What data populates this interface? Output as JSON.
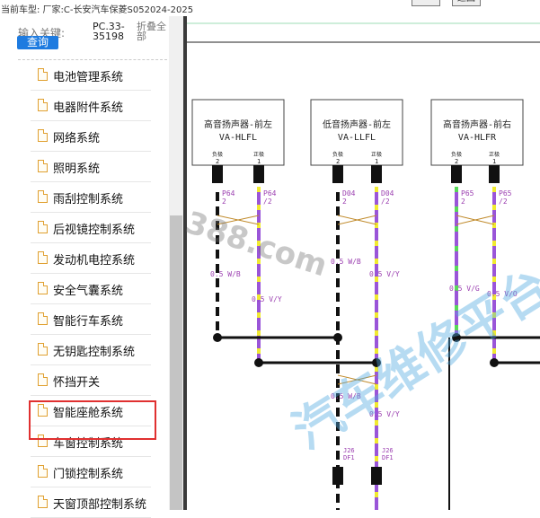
{
  "header": {
    "vehicle_label": "当前车型:  厂家:C-长安汽车保菱S052024-2025",
    "button_label": "返回"
  },
  "sidebar": {
    "search_label": "输入关键:",
    "query_button": "查询",
    "code_label": "PC.33-35198",
    "collapse_label": "折叠全部",
    "items": [
      {
        "label": "电池管理系统"
      },
      {
        "label": "电器附件系统"
      },
      {
        "label": "网络系统"
      },
      {
        "label": "照明系统"
      },
      {
        "label": "雨刮控制系统"
      },
      {
        "label": "后视镜控制系统"
      },
      {
        "label": "发动机电控系统"
      },
      {
        "label": "安全气囊系统"
      },
      {
        "label": "智能行车系统"
      },
      {
        "label": "无钥匙控制系统"
      },
      {
        "label": "怀挡开关"
      },
      {
        "label": "智能座舱系统"
      },
      {
        "label": "车窗控制系统"
      },
      {
        "label": "门锁控制系统"
      },
      {
        "label": "天窗顶部控制系统"
      }
    ],
    "highlighted_item": "智能座舱系统"
  },
  "diagram": {
    "components": [
      {
        "title": "高音扬声器-前左",
        "code": "VA-HLFL",
        "pin_left": "负极",
        "pin_right": "正极"
      },
      {
        "title": "低音扬声器-前左",
        "code": "VA-LLFL",
        "pin_left": "负极",
        "pin_right": "正极"
      },
      {
        "title": "高音扬声器-前右",
        "code": "VA-HLFR",
        "pin_left": "负极",
        "pin_right": "正极"
      }
    ],
    "connectors": [
      "P64",
      "P64",
      "D04",
      "D04",
      "P65",
      "P65"
    ],
    "pins": [
      "2",
      "/2",
      "2",
      "/2",
      "2",
      "/2"
    ],
    "pin_numbers": [
      "2",
      "1",
      "2",
      "1",
      "2",
      "1"
    ],
    "wire_labels": [
      "0.5 W/B",
      "0.5 V/Y",
      "0.5 W/B",
      "0.5 V/Y",
      "0.5 V/G",
      "0.5 V/O",
      "0.5 W/B",
      "0.5 V/Y"
    ],
    "bottom_connectors": [
      "J26",
      "J26"
    ],
    "bottom_pins": [
      "DF1",
      "DF1"
    ],
    "colors": {
      "violet": "#9a55d8",
      "yellow": "#f0ea30",
      "green": "#58d858",
      "black": "#111111",
      "white": "#ffffff",
      "label_purple": "#9b3fb0",
      "highlight_red": "#e03030"
    },
    "watermarks": [
      "388.com",
      "汽车维修平台"
    ]
  }
}
